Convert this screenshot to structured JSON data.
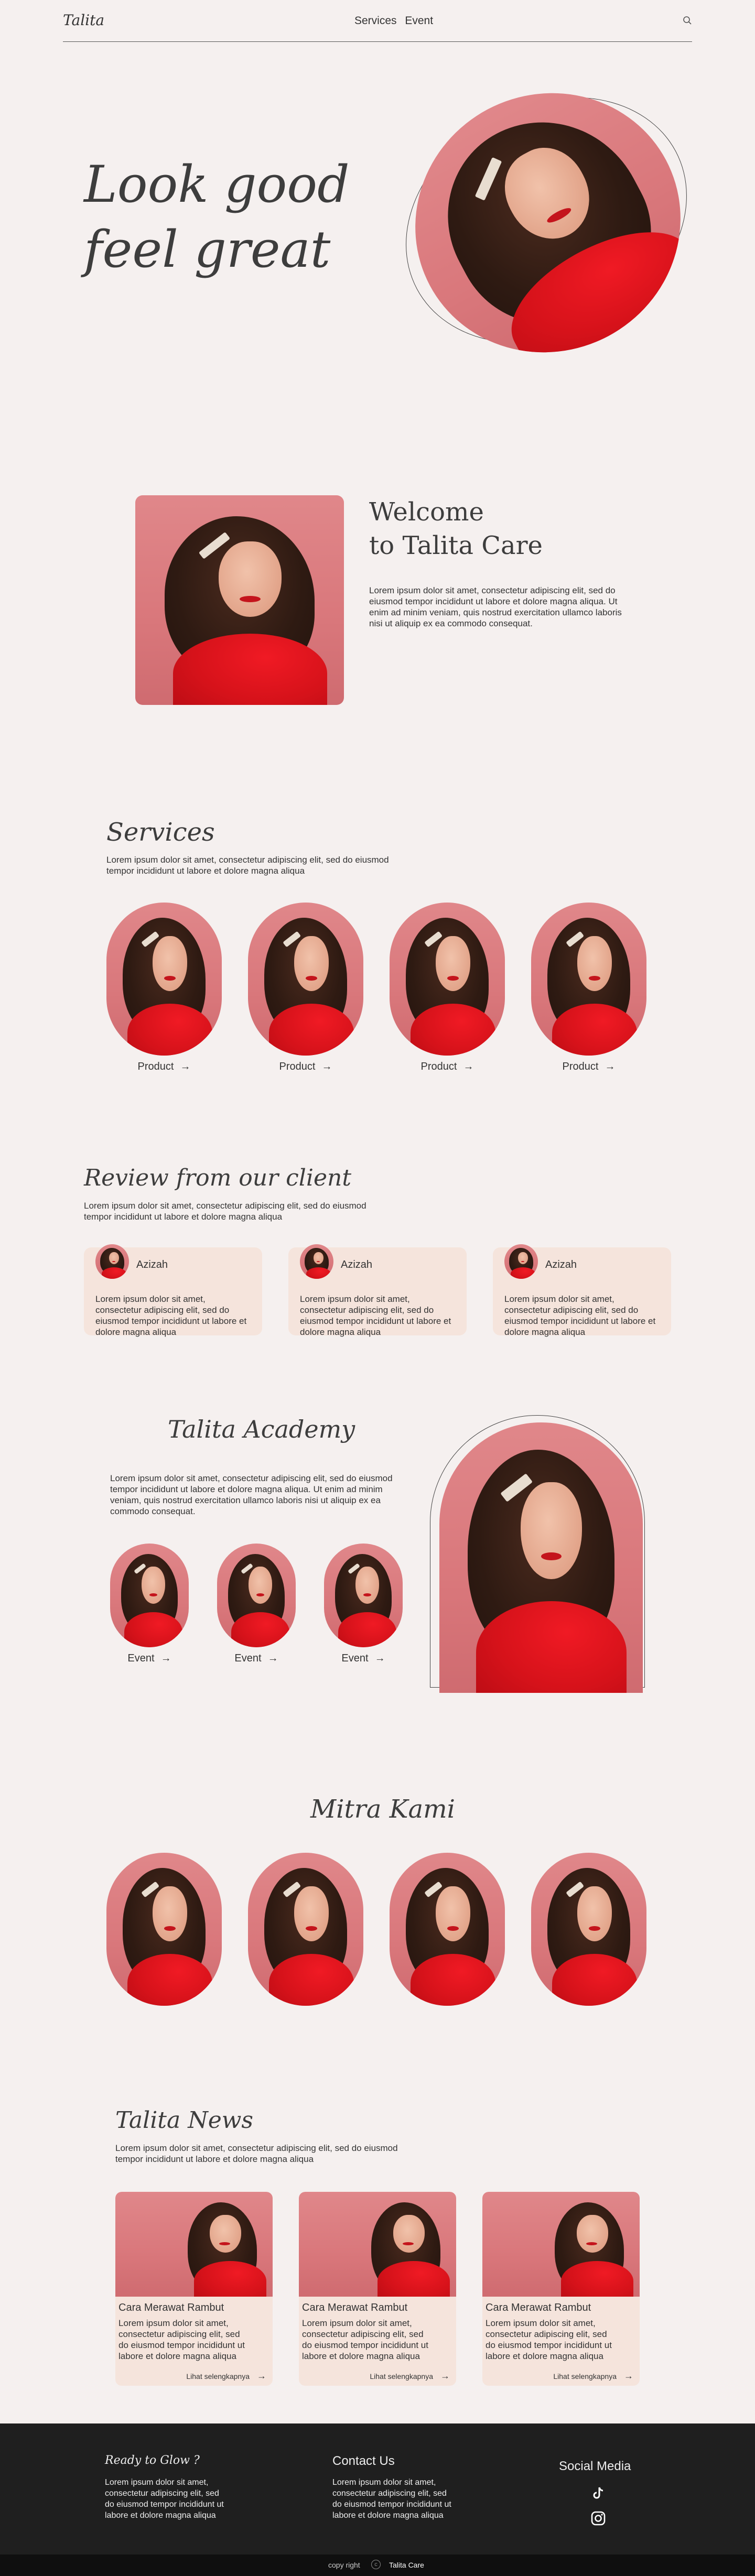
{
  "header": {
    "logo": "Talita",
    "nav": [
      "Services",
      "Event"
    ],
    "search_icon": "search-icon"
  },
  "hero": {
    "line1": "Look good",
    "line2": "feel great"
  },
  "welcome": {
    "title_line1": "Welcome",
    "title_line2": "to Talita Care",
    "text": "Lorem ipsum dolor sit amet, consectetur adipiscing elit, sed do eiusmod tempor incididunt ut labore et dolore magna aliqua. Ut enim ad minim veniam, quis nostrud exercitation ullamco laboris nisi ut aliquip ex ea commodo consequat."
  },
  "services": {
    "title": "Services",
    "text": "Lorem ipsum dolor sit amet, consectetur adipiscing elit, sed do eiusmod tempor incididunt ut labore et dolore magna aliqua",
    "items": [
      {
        "label": "Product"
      },
      {
        "label": "Product"
      },
      {
        "label": "Product"
      },
      {
        "label": "Product"
      }
    ],
    "arrow": "→"
  },
  "reviews": {
    "title": "Review from our client",
    "text": "Lorem ipsum dolor sit amet, consectetur adipiscing elit, sed do eiusmod tempor incididunt ut labore et dolore magna aliqua",
    "items": [
      {
        "name": "Azizah",
        "text": "Lorem ipsum dolor sit amet, consectetur adipiscing elit, sed do eiusmod tempor incididunt ut labore et dolore magna aliqua"
      },
      {
        "name": "Azizah",
        "text": "Lorem ipsum dolor sit amet, consectetur adipiscing elit, sed do eiusmod tempor incididunt ut labore et dolore magna aliqua"
      },
      {
        "name": "Azizah",
        "text": "Lorem ipsum dolor sit amet, consectetur adipiscing elit, sed do eiusmod tempor incididunt ut labore et dolore magna aliqua"
      }
    ]
  },
  "academy": {
    "title": "Talita Academy",
    "text": "Lorem ipsum dolor sit amet, consectetur adipiscing elit, sed do eiusmod tempor incididunt ut labore et dolore magna aliqua. Ut enim ad minim veniam, quis nostrud exercitation ullamco laboris nisi ut aliquip ex ea commodo consequat.",
    "events": [
      {
        "label": "Event"
      },
      {
        "label": "Event"
      },
      {
        "label": "Event"
      }
    ]
  },
  "mitra": {
    "title": "Mitra Kami"
  },
  "news": {
    "title": "Talita News",
    "text": "Lorem ipsum dolor sit amet, consectetur adipiscing elit, sed do eiusmod tempor incididunt ut labore et dolore magna aliqua",
    "items": [
      {
        "title": "Cara Merawat Rambut",
        "text": "Lorem ipsum dolor sit amet, consectetur adipiscing elit, sed do eiusmod tempor incididunt ut labore et dolore magna aliqua",
        "more": "Lihat selengkapnya"
      },
      {
        "title": "Cara Merawat Rambut",
        "text": "Lorem ipsum dolor sit amet, consectetur adipiscing elit, sed do eiusmod tempor incididunt ut labore et dolore magna aliqua",
        "more": "Lihat selengkapnya"
      },
      {
        "title": "Cara Merawat Rambut",
        "text": "Lorem ipsum dolor sit amet, consectetur adipiscing elit, sed do eiusmod tempor incididunt ut labore et dolore magna aliqua",
        "more": "Lihat selengkapnya"
      }
    ]
  },
  "footer": {
    "col1_title": "Ready to Glow ?",
    "col1_text": "Lorem ipsum dolor sit amet, consectetur adipiscing elit, sed do eiusmod tempor incididunt ut labore et dolore magna aliqua",
    "col2_title": "Contact Us",
    "col2_text": "Lorem ipsum dolor sit amet, consectetur adipiscing elit, sed do eiusmod tempor incididunt ut labore et dolore magna aliqua",
    "social_title": "Social Media",
    "social_icons": [
      "tiktok-icon",
      "instagram-icon"
    ],
    "copy": "copy right",
    "copy_symbol": "c",
    "brand": "Talita Care"
  },
  "colors": {
    "background": "#f5f0ef",
    "portrait_bg": "#e0878a",
    "card_bg": "#f5e4dc",
    "footer_bg": "#1f1f1f"
  }
}
